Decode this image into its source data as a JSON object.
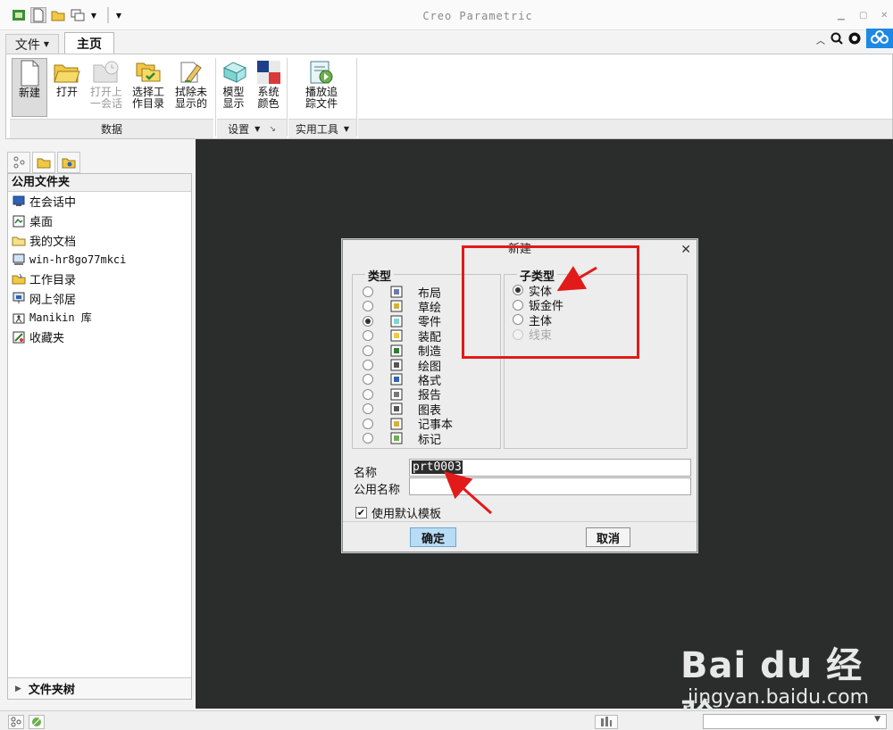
{
  "window": {
    "title": "Creo Parametric"
  },
  "tabs": {
    "file": "文件",
    "home": "主页"
  },
  "ribbon": {
    "groups": [
      {
        "label": "数据",
        "buttons": [
          {
            "label": "新建",
            "icon": "new-file-icon"
          },
          {
            "label": "打开",
            "icon": "open-folder-icon"
          },
          {
            "label": "打开上\n一会话",
            "icon": "open-last-session-icon",
            "disabled": true
          },
          {
            "label": "选择工\n作目录",
            "icon": "select-working-directory-icon"
          },
          {
            "label": "拭除未\n显示的",
            "icon": "erase-not-displayed-icon"
          }
        ]
      },
      {
        "label": "设置",
        "buttons": [
          {
            "label": "模型\n显示",
            "icon": "model-display-icon"
          },
          {
            "label": "系统\n颜色",
            "icon": "system-colors-icon"
          }
        ]
      },
      {
        "label": "实用工具",
        "buttons": [
          {
            "label": "播放追\n踪文件",
            "icon": "play-trail-file-icon"
          }
        ]
      }
    ]
  },
  "navigator": {
    "header": "公用文件夹",
    "items": [
      {
        "label": "在会话中",
        "icon": "in-session-icon"
      },
      {
        "label": "桌面",
        "icon": "desktop-icon"
      },
      {
        "label": "我的文档",
        "icon": "my-documents-icon"
      },
      {
        "label": "win-hr8go77mkci",
        "icon": "computer-icon"
      },
      {
        "label": "工作目录",
        "icon": "working-directory-icon"
      },
      {
        "label": "网上邻居",
        "icon": "network-icon"
      },
      {
        "label": "Manikin 库",
        "icon": "manikin-library-icon"
      },
      {
        "label": "收藏夹",
        "icon": "favorites-icon"
      }
    ],
    "footer": "文件夹树"
  },
  "dialog": {
    "title": "新建",
    "type_legend": "类型",
    "subtype_legend": "子类型",
    "types": [
      {
        "label": "布局",
        "checked": false
      },
      {
        "label": "草绘",
        "checked": false
      },
      {
        "label": "零件",
        "checked": true
      },
      {
        "label": "装配",
        "checked": false
      },
      {
        "label": "制造",
        "checked": false
      },
      {
        "label": "绘图",
        "checked": false
      },
      {
        "label": "格式",
        "checked": false
      },
      {
        "label": "报告",
        "checked": false
      },
      {
        "label": "图表",
        "checked": false
      },
      {
        "label": "记事本",
        "checked": false
      },
      {
        "label": "标记",
        "checked": false
      }
    ],
    "subtypes": [
      {
        "label": "实体",
        "checked": true,
        "disabled": false
      },
      {
        "label": "钣金件",
        "checked": false,
        "disabled": false
      },
      {
        "label": "主体",
        "checked": false,
        "disabled": false
      },
      {
        "label": "线束",
        "checked": false,
        "disabled": true
      }
    ],
    "name_label": "名称",
    "name_value": "prt0003",
    "common_name_label": "公用名称",
    "common_name_value": "",
    "use_default_template_label": "使用默认模板",
    "use_default_template_checked": true,
    "ok_label": "确定",
    "cancel_label": "取消"
  },
  "annotations": {
    "highlight_color": "#e21a1a"
  },
  "watermark": {
    "logo": "Bai du 经验",
    "url": "jingyan.baidu.com"
  },
  "colors": {
    "graphics_bg": "#2b2d2d",
    "ok_button": "#b9dcf5"
  }
}
